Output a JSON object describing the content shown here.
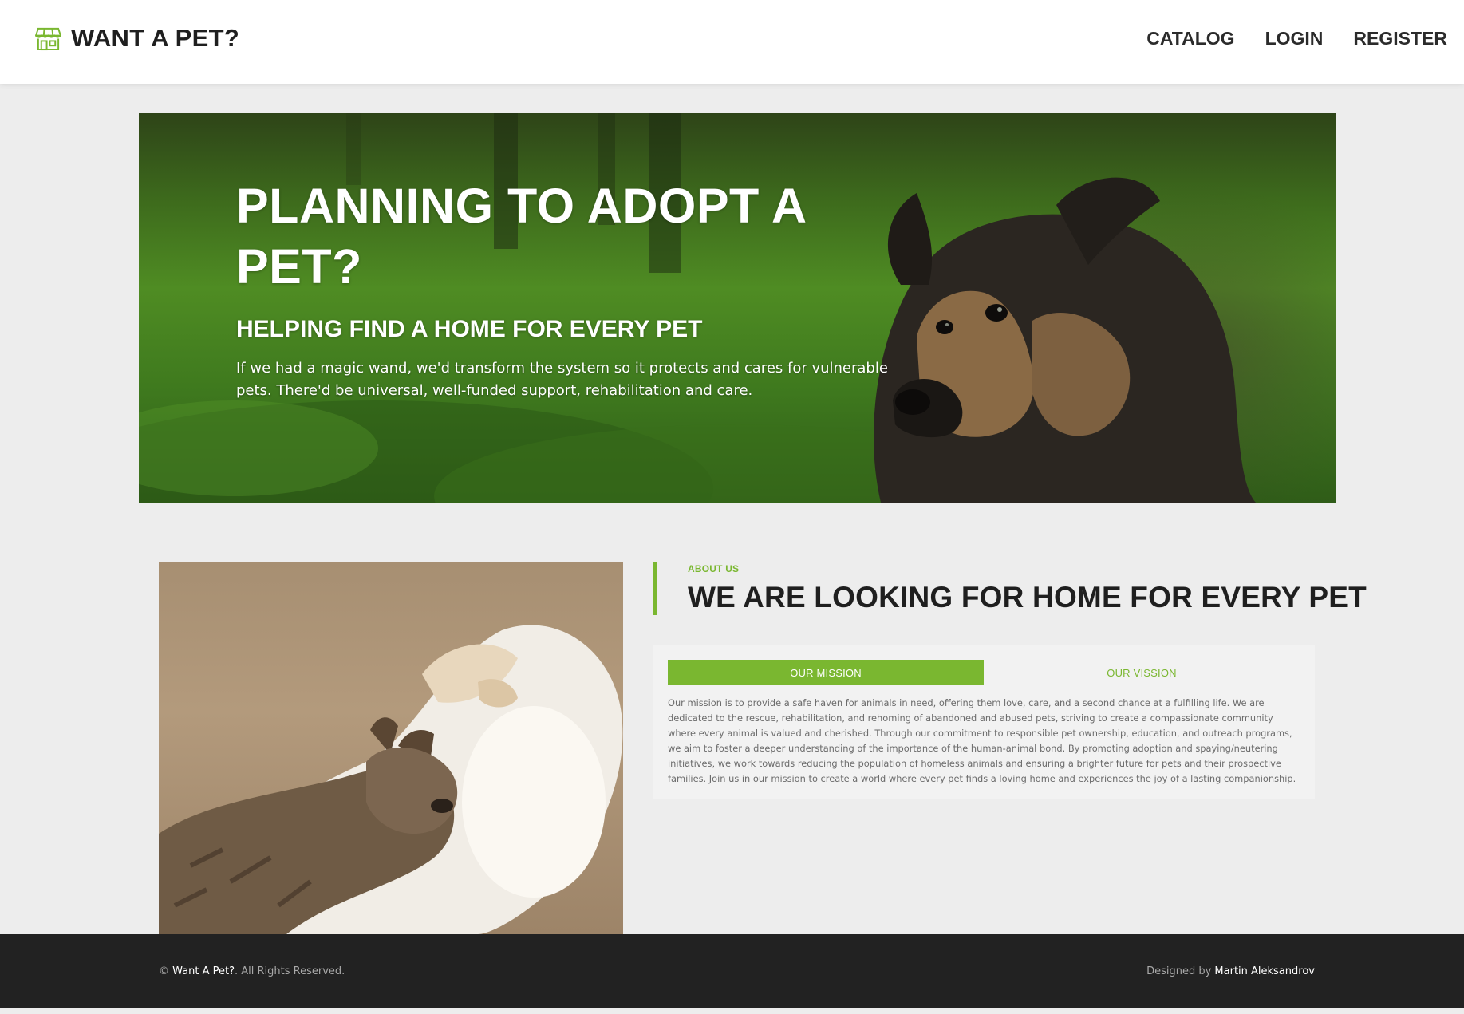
{
  "header": {
    "brand": "WANT A PET?",
    "brand_icon": "storefront-icon",
    "accent_color": "#7ab730",
    "nav": [
      "CATALOG",
      "LOGIN",
      "REGISTER"
    ]
  },
  "hero": {
    "title": "PLANNING TO ADOPT A PET?",
    "subtitle": "HELPING FIND A HOME FOR EVERY PET",
    "description": "If we had a magic wand, we'd transform the system so it protects and cares for vulnerable pets. There'd be universal, well-funded support, rehabilitation and care."
  },
  "about": {
    "tag": "ABOUT US",
    "title": "WE ARE LOOKING FOR HOME FOR EVERY PET",
    "tabs": [
      {
        "label": "OUR MISSION",
        "active": true
      },
      {
        "label": "OUR VISSION",
        "active": false
      }
    ],
    "content": "Our mission is to provide a safe haven for animals in need, offering them love, care, and a second chance at a fulfilling life. We are dedicated to the rescue, rehabilitation, and rehoming of abandoned and abused pets, striving to create a compassionate community where every animal is valued and cherished. Through our commitment to responsible pet ownership, education, and outreach programs, we aim to foster a deeper understanding of the importance of the human-animal bond. By promoting adoption and spaying/neutering initiatives, we work towards reducing the population of homeless animals and ensuring a brighter future for pets and their prospective families. Join us in our mission to create a world where every pet finds a loving home and experiences the joy of a lasting companionship."
  },
  "footer": {
    "copyright_symbol": "©",
    "site_name": "Want A Pet?",
    "rights": ". All Rights Reserved.",
    "designed_by": "Designed by",
    "designer": "Martin Aleksandrov"
  }
}
